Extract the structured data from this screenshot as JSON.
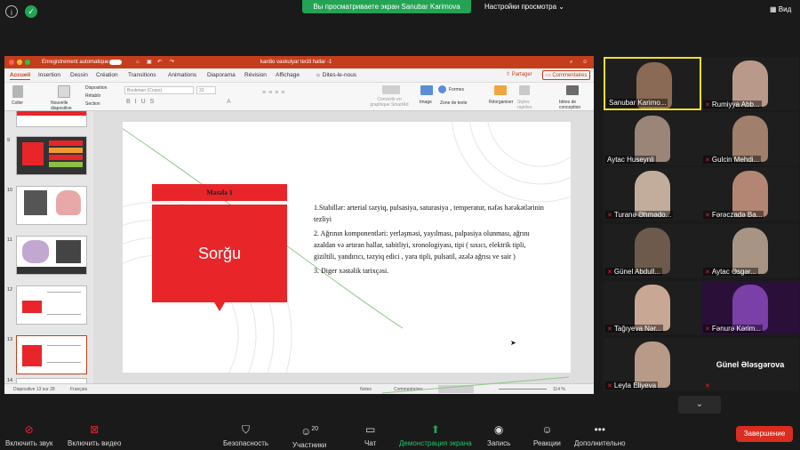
{
  "zoom": {
    "share_banner": "Вы просматриваете экран Sanubar Karimova",
    "view_options": "Настройки просмотра",
    "view": "Вид",
    "toolbar": {
      "mute": "Включить звук",
      "video": "Включить видео",
      "security": "Безопасность",
      "participants": "Участники",
      "participants_count": "20",
      "chat": "Чат",
      "share": "Демонстрация экрана",
      "record": "Запись",
      "reactions": "Реакции",
      "more": "Дополнительно",
      "end": "Завершение"
    },
    "colors": {
      "share_green": "#23a455",
      "end_red": "#d92d1f",
      "active_border": "#f2e02c"
    }
  },
  "ppt": {
    "autosave": "Enregistrement automatique",
    "title": "kardio vaskulyar tecili hallar -1",
    "tabs": [
      "Accueil",
      "Insertion",
      "Dessin",
      "Création",
      "Transitions",
      "Animations",
      "Diaporama",
      "Révision",
      "Affichage",
      "Dites-le-nous"
    ],
    "share": "Partager",
    "comments": "Commentaires",
    "ribbon": {
      "paste": "Coller",
      "new_slide": "Nouvelle diapositive",
      "layout": "Disposition",
      "reset": "Rétablir",
      "section": "Section",
      "font": "Bookman (Corps)",
      "size": "32",
      "convert": "Convertir en graphique SmartArt",
      "image": "Image",
      "shapes": "Formes",
      "textbox": "Zone de texte",
      "arrange": "Réorganiser",
      "styles": "Styles rapides",
      "ideas": "Idées de conception"
    },
    "thumbs": [
      "9",
      "10",
      "11",
      "12",
      "13",
      "14"
    ],
    "slide": {
      "tag": "Məsələ 1",
      "heading": "Sorğu",
      "p1": "1.Stabillər: arterial təzyiq, pulsasiya, saturasiya , temperatur, nəfəs hərəkətlərinin tezliyi",
      "p2": "2. Ağrının komponentləri: yerləşməsi, yayılması, palpasiya olunması, ağrını azaldan və artıran hallar, sabitliyi, xronologiyası, tipi ( sıxıcı, elektrik tipli, giziltili, yandırıcı, təzyiq edici , yara tipli, pulsatil, əzələ ağrısı ve sair )",
      "p3": "3. Diger xəstəlik tarixçəsi."
    },
    "status": {
      "slide": "Diapositive 13 sur 28",
      "lang": "Français",
      "notes": "Notes",
      "comments": "Commentaires",
      "zoom": "114 %"
    }
  },
  "gallery": [
    {
      "name": "Sanubar Karimo...",
      "muted": false
    },
    {
      "name": "Rumiyya Abb...",
      "muted": true
    },
    {
      "name": "Aytac Huseynli",
      "muted": false
    },
    {
      "name": "Gulcin Mehdi...",
      "muted": true
    },
    {
      "name": "Turanə Əhmədo...",
      "muted": true
    },
    {
      "name": "Fərəczadə Ba...",
      "muted": true
    },
    {
      "name": "Günel Abdull...",
      "muted": true
    },
    {
      "name": "Aytac Əsgər...",
      "muted": true
    },
    {
      "name": "Tağıyeva Nər...",
      "muted": true
    },
    {
      "name": "Fənurə Kərim...",
      "muted": true
    },
    {
      "name": "Leyla Eliyeva",
      "muted": true
    },
    {
      "name": "Günel Ələsgərova",
      "muted": true
    }
  ]
}
